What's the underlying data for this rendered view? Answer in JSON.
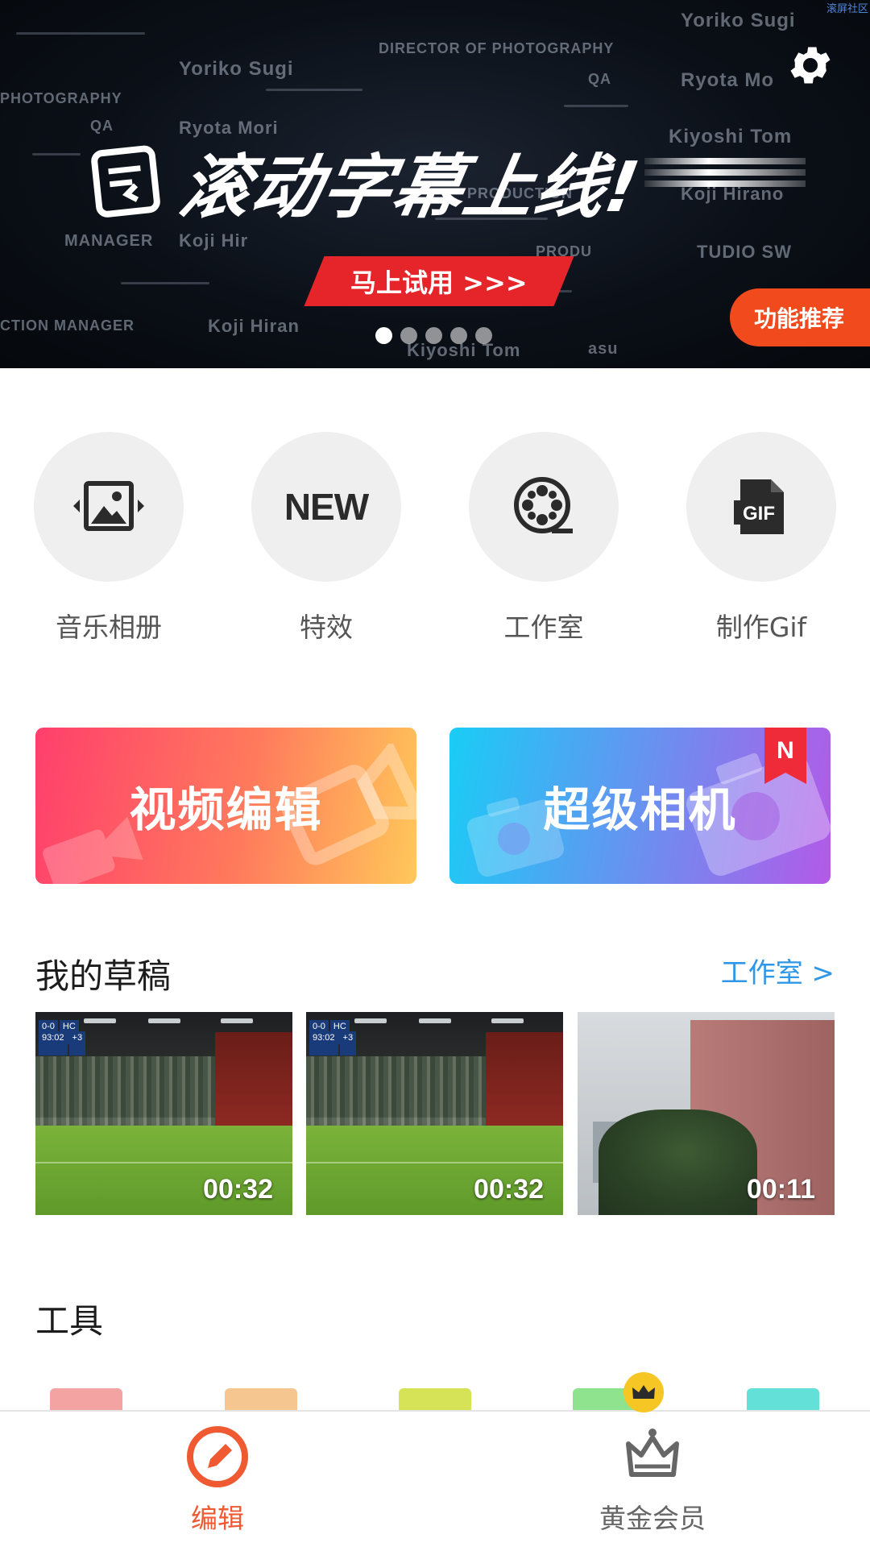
{
  "banner": {
    "corner_tag": "滚屏社区",
    "headline": "滚动字幕上线!",
    "cta": "马上试用 >>>",
    "badge": "功能推荐",
    "credits": [
      "Yoriko Sugi",
      "DIRECTOR OF PHOTOGRAPHY",
      "Ryota Mori",
      "QA",
      "PHOTOGRAPHY",
      "Yoriko Sugi",
      "Ryota Mo",
      "Kiyoshi Tom",
      "Koji Hirano",
      "PRODUCTION",
      "MANAGER",
      "Koji Hir",
      "TUDIO SW",
      "PRODU",
      "CTION MANAGER",
      "Koji Hiran",
      "Kiyoshi Tom",
      "asu",
      "QA"
    ],
    "page_count": 5,
    "active_page": 1
  },
  "quick_actions": [
    {
      "label": "音乐相册",
      "icon": "photo-arrows-icon"
    },
    {
      "label": "特效",
      "icon": "new-icon",
      "icon_text": "NEW"
    },
    {
      "label": "工作室",
      "icon": "film-reel-icon"
    },
    {
      "label": "制作Gif",
      "icon": "gif-file-icon",
      "icon_text": "GIF"
    }
  ],
  "cards": {
    "video_edit": "视频编辑",
    "super_camera": "超级相机",
    "super_camera_badge": "N"
  },
  "drafts": {
    "title": "我的草稿",
    "link": "工作室 >",
    "items": [
      {
        "duration": "00:32",
        "scene": "stadium",
        "score_left": "0-0",
        "score_team": "HC",
        "score_time": "93:02",
        "score_extra": "+3"
      },
      {
        "duration": "00:32",
        "scene": "stadium",
        "score_left": "0-0",
        "score_team": "HC",
        "score_time": "93:02",
        "score_extra": "+3"
      },
      {
        "duration": "00:11",
        "scene": "building"
      }
    ]
  },
  "tools": {
    "title": "工具",
    "chip_colors": [
      "#f4a3a3",
      "#f6c690",
      "#d6e357",
      "#8fe38f",
      "#63e0d8"
    ]
  },
  "bottom_nav": {
    "edit": "编辑",
    "vip": "黄金会员",
    "active_color": "#ef5a32",
    "inactive_color": "#666666"
  }
}
